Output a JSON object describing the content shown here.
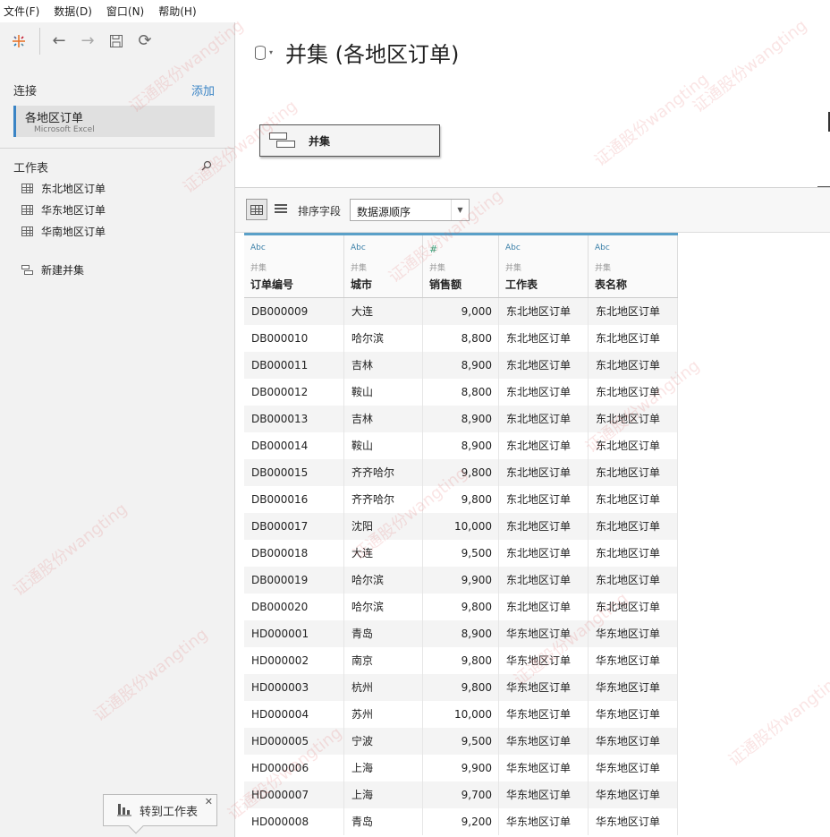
{
  "menu": [
    "文件(F)",
    "数据(D)",
    "窗口(N)",
    "帮助(H)"
  ],
  "sidebar": {
    "connections_label": "连接",
    "add_label": "添加",
    "connection": {
      "name": "各地区订单",
      "type": "Microsoft Excel"
    },
    "worksheets_label": "工作表",
    "sheets": [
      "东北地区订单",
      "华东地区订单",
      "华南地区订单"
    ],
    "new_union": "新建并集",
    "goto_worksheet": "转到工作表"
  },
  "canvas": {
    "title": "并集 (各地区订单)",
    "union_label": "并集"
  },
  "grid_toolbar": {
    "sort_label": "排序字段",
    "sort_value": "数据源顺序"
  },
  "table": {
    "columns": [
      {
        "type": "Abc",
        "source": "并集",
        "name": "订单编号"
      },
      {
        "type": "Abc",
        "source": "并集",
        "name": "城市"
      },
      {
        "type": "#",
        "source": "并集",
        "name": "销售额"
      },
      {
        "type": "Abc",
        "source": "并集",
        "name": "工作表"
      },
      {
        "type": "Abc",
        "source": "并集",
        "name": "表名称"
      }
    ],
    "rows": [
      [
        "DB000009",
        "大连",
        "9,000",
        "东北地区订单",
        "东北地区订单"
      ],
      [
        "DB000010",
        "哈尔滨",
        "8,800",
        "东北地区订单",
        "东北地区订单"
      ],
      [
        "DB000011",
        "吉林",
        "8,900",
        "东北地区订单",
        "东北地区订单"
      ],
      [
        "DB000012",
        "鞍山",
        "8,800",
        "东北地区订单",
        "东北地区订单"
      ],
      [
        "DB000013",
        "吉林",
        "8,900",
        "东北地区订单",
        "东北地区订单"
      ],
      [
        "DB000014",
        "鞍山",
        "8,900",
        "东北地区订单",
        "东北地区订单"
      ],
      [
        "DB000015",
        "齐齐哈尔",
        "9,800",
        "东北地区订单",
        "东北地区订单"
      ],
      [
        "DB000016",
        "齐齐哈尔",
        "9,800",
        "东北地区订单",
        "东北地区订单"
      ],
      [
        "DB000017",
        "沈阳",
        "10,000",
        "东北地区订单",
        "东北地区订单"
      ],
      [
        "DB000018",
        "大连",
        "9,500",
        "东北地区订单",
        "东北地区订单"
      ],
      [
        "DB000019",
        "哈尔滨",
        "9,900",
        "东北地区订单",
        "东北地区订单"
      ],
      [
        "DB000020",
        "哈尔滨",
        "9,800",
        "东北地区订单",
        "东北地区订单"
      ],
      [
        "HD000001",
        "青岛",
        "8,900",
        "华东地区订单",
        "华东地区订单"
      ],
      [
        "HD000002",
        "南京",
        "9,800",
        "华东地区订单",
        "华东地区订单"
      ],
      [
        "HD000003",
        "杭州",
        "9,800",
        "华东地区订单",
        "华东地区订单"
      ],
      [
        "HD000004",
        "苏州",
        "10,000",
        "华东地区订单",
        "华东地区订单"
      ],
      [
        "HD000005",
        "宁波",
        "9,500",
        "华东地区订单",
        "华东地区订单"
      ],
      [
        "HD000006",
        "上海",
        "9,900",
        "华东地区订单",
        "华东地区订单"
      ],
      [
        "HD000007",
        "上海",
        "9,700",
        "华东地区订单",
        "华东地区订单"
      ],
      [
        "HD000008",
        "青岛",
        "9,200",
        "华东地区订单",
        "华东地区订单"
      ]
    ]
  },
  "watermark": "证通股份wangting"
}
